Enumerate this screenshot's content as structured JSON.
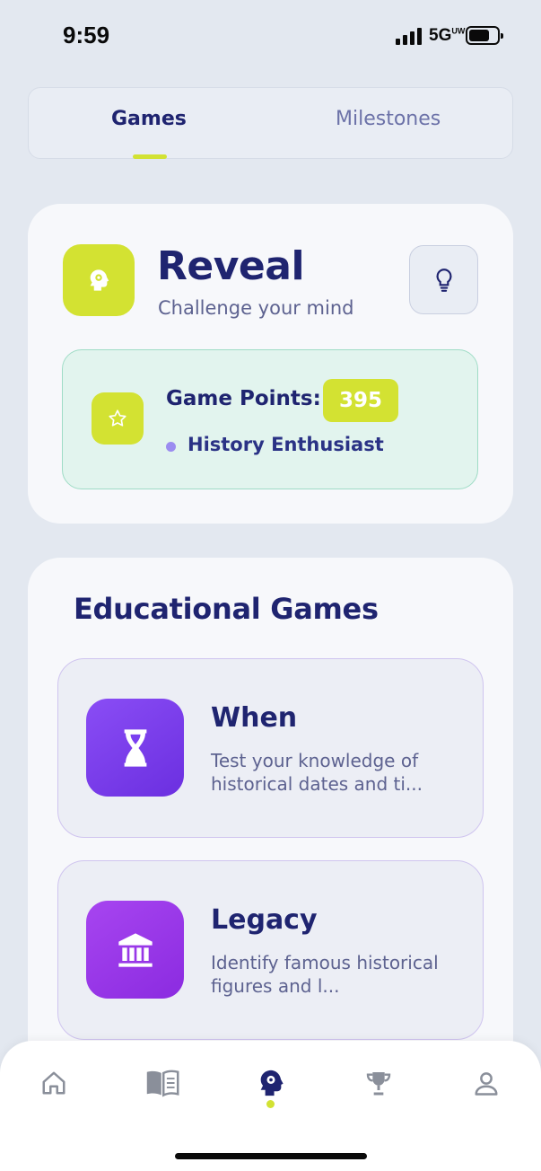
{
  "status_bar": {
    "time": "9:59",
    "network": "5G",
    "network_sup": "UW"
  },
  "tabs": [
    {
      "label": "Games"
    },
    {
      "label": "Milestones"
    }
  ],
  "header": {
    "title": "Reveal",
    "subtitle": "Challenge your mind"
  },
  "points": {
    "label": "Game Points:",
    "value": "395",
    "rank": "History Enthusiast"
  },
  "section": {
    "title": "Educational Games"
  },
  "games": [
    {
      "title": "When",
      "description": "Test your knowledge of historical dates and ti...",
      "icon": "hourglass-icon"
    },
    {
      "title": "Legacy",
      "description": "Identify famous historical figures and l...",
      "icon": "museum-icon"
    }
  ],
  "nav": [
    {
      "icon": "home-icon"
    },
    {
      "icon": "book-icon"
    },
    {
      "icon": "brain-gear-icon",
      "active": true
    },
    {
      "icon": "trophy-icon"
    },
    {
      "icon": "profile-icon"
    }
  ],
  "colors": {
    "accent": "#d3e232",
    "primary": "#1f2470",
    "purple": "#7b3ff0"
  }
}
